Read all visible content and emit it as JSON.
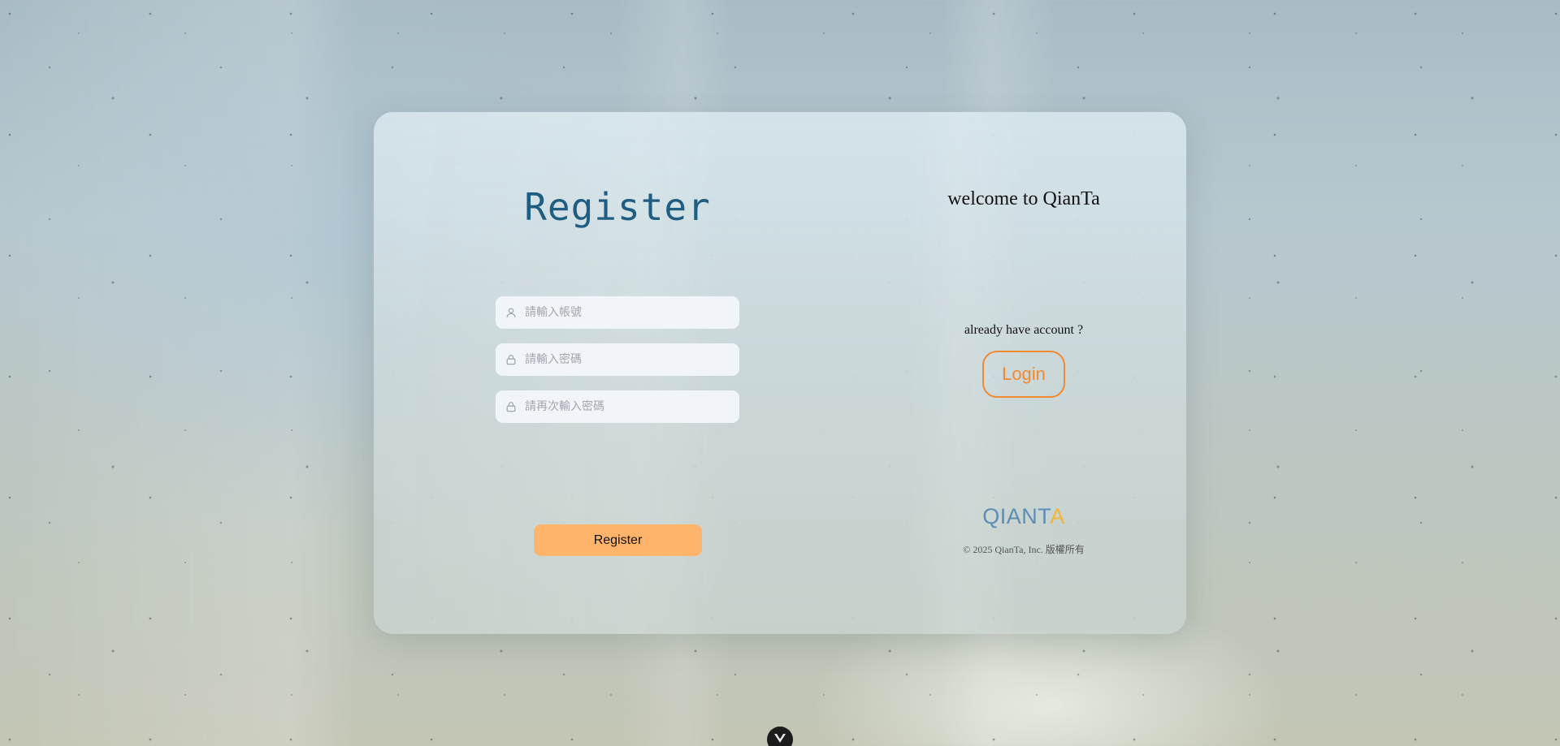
{
  "register": {
    "title": "Register",
    "fields": [
      {
        "placeholder": "請輸入帳號",
        "icon": "user-icon"
      },
      {
        "placeholder": "請輸入密碼",
        "icon": "lock-icon"
      },
      {
        "placeholder": "請再次輸入密碼",
        "icon": "lock-icon"
      }
    ],
    "submit_label": "Register",
    "submit_color": "#feb46b"
  },
  "side": {
    "welcome": "welcome to QianTa",
    "already_text": "already have account ?",
    "login_label": "Login",
    "login_color": "#f08a30",
    "logo_main": "QIANT",
    "logo_accent": "A",
    "logo_color": "#5d8db5",
    "logo_accent_color": "#f0b53a",
    "copyright": "© 2025 QianTa, Inc. 版權所有"
  },
  "devtools": {
    "icon": "vue-devtools-icon"
  }
}
